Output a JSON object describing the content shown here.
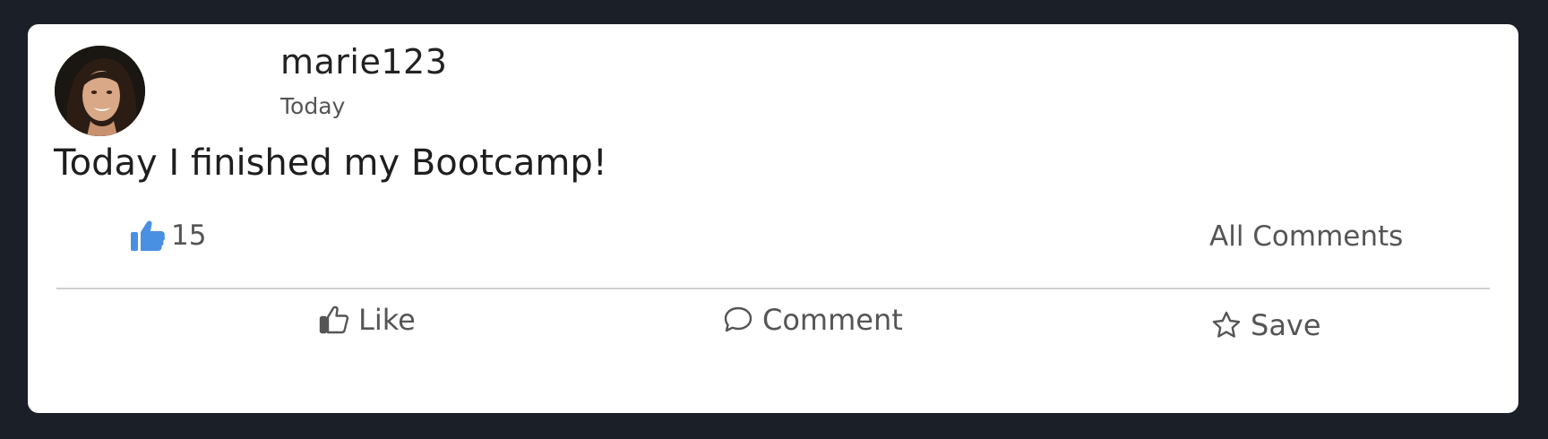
{
  "post": {
    "username": "marie123",
    "time": "Today",
    "text": "Today I finished my Bootcamp!",
    "like_count": "15",
    "all_comments_label": "All Comments"
  },
  "actions": {
    "like_label": "Like",
    "comment_label": "Comment",
    "save_label": "Save"
  },
  "icons": {
    "like_count": "thumbs-up-filled-icon",
    "like": "thumbs-up-outline-icon",
    "comment": "speech-bubble-icon",
    "save": "star-outline-icon"
  },
  "colors": {
    "background": "#1b1f27",
    "card": "#ffffff",
    "accent": "#4a90e2",
    "muted_text": "#555555"
  }
}
